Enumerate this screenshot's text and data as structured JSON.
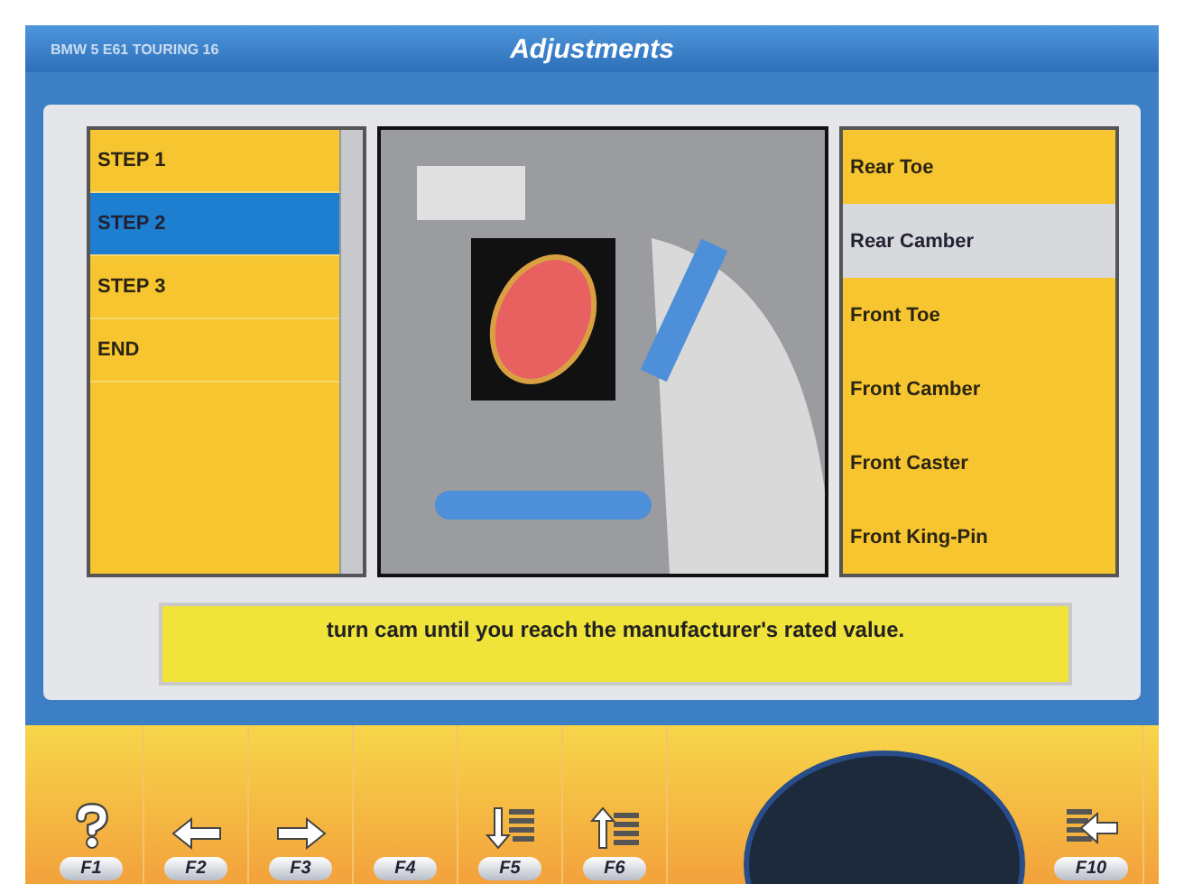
{
  "header": {
    "vehicle": "BMW 5 E61 TOURING 16",
    "title": "Adjustments"
  },
  "steps": [
    {
      "label": "STEP 1",
      "selected": false
    },
    {
      "label": "STEP 2",
      "selected": true
    },
    {
      "label": "STEP 3",
      "selected": false
    },
    {
      "label": "END",
      "selected": false
    }
  ],
  "adjustments": [
    {
      "label": "Rear Toe",
      "selected": false
    },
    {
      "label": "Rear Camber",
      "selected": true
    },
    {
      "label": "Front Toe",
      "selected": false
    },
    {
      "label": "Front Camber",
      "selected": false
    },
    {
      "label": "Front Caster",
      "selected": false
    },
    {
      "label": "Front King-Pin",
      "selected": false
    }
  ],
  "message": "turn cam until you reach the manufacturer's rated value.",
  "function_keys": [
    {
      "key": "F1",
      "kind": "help"
    },
    {
      "key": "F2",
      "kind": "back"
    },
    {
      "key": "F3",
      "kind": "next"
    },
    {
      "key": "F4",
      "kind": "blank"
    },
    {
      "key": "F5",
      "kind": "down"
    },
    {
      "key": "F6",
      "kind": "up"
    },
    {
      "key": "F10",
      "kind": "exit"
    }
  ]
}
